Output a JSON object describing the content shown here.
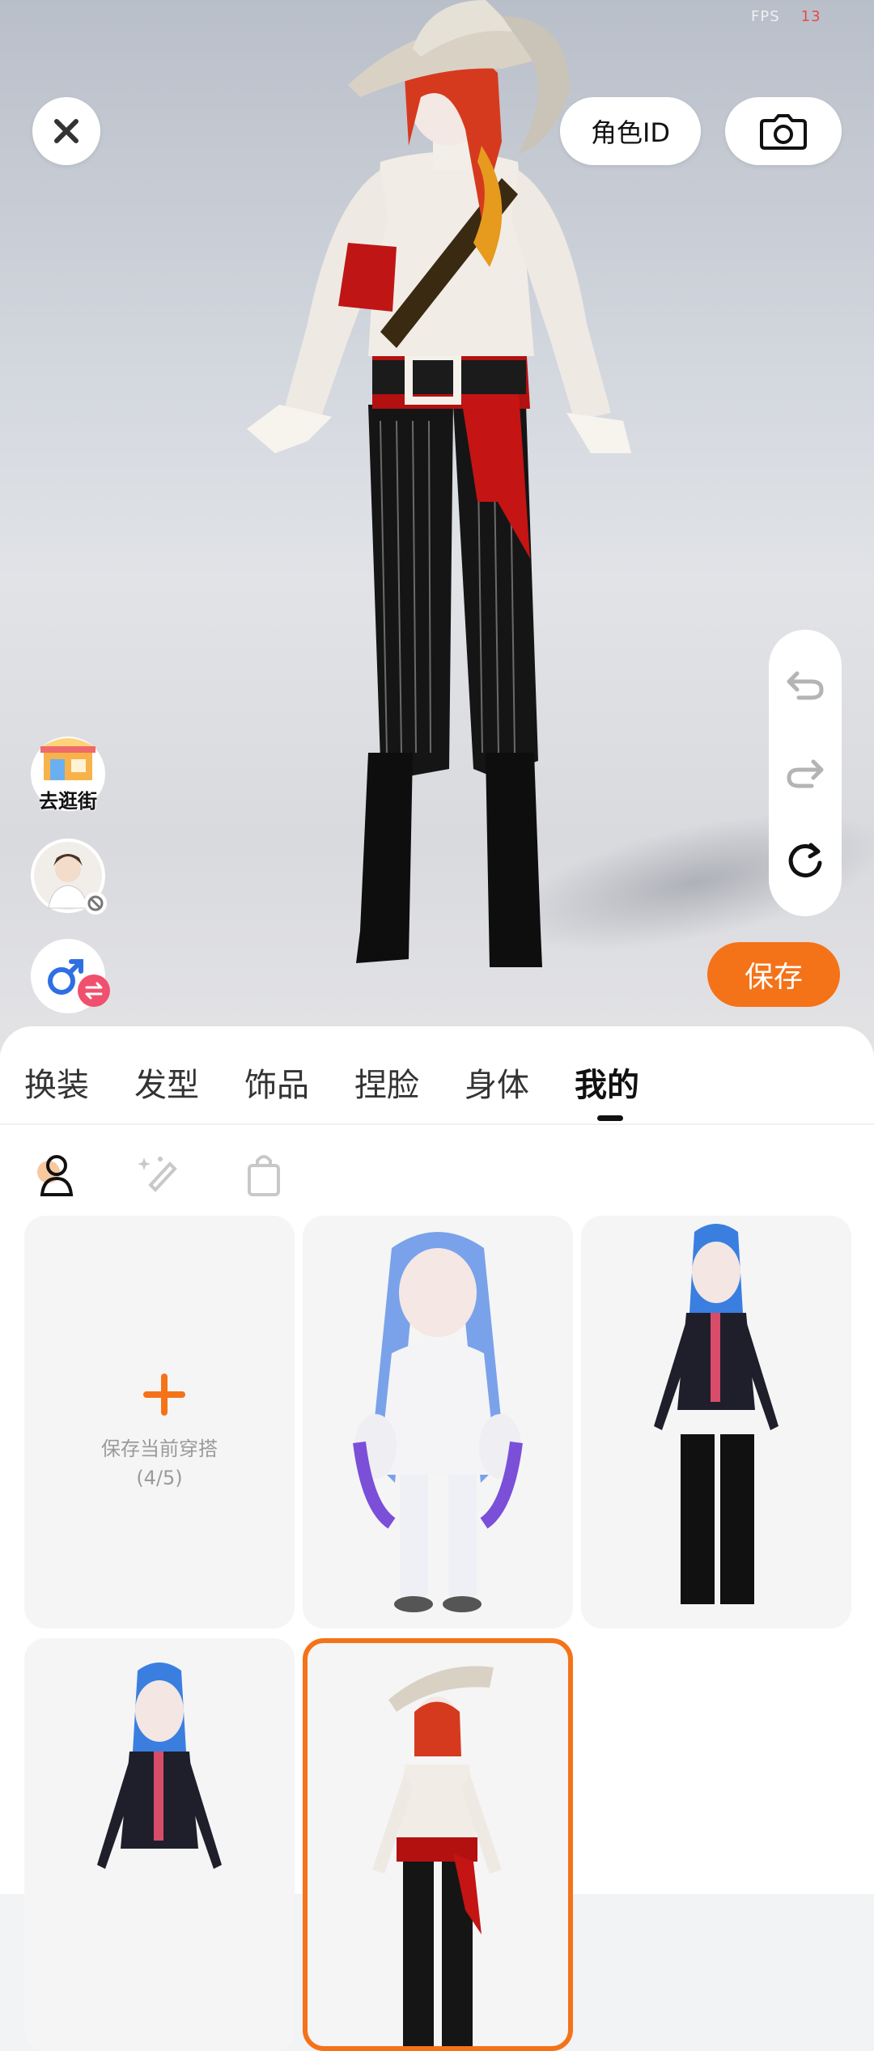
{
  "hud": {
    "fps_label": "FPS",
    "fps_value": "13"
  },
  "top_bar": {
    "role_id_label": "角色ID"
  },
  "side": {
    "shop_label": "去逛街"
  },
  "actions": {
    "save_label": "保存"
  },
  "tabs": [
    {
      "label": "换装",
      "active": false
    },
    {
      "label": "发型",
      "active": false
    },
    {
      "label": "饰品",
      "active": false
    },
    {
      "label": "捏脸",
      "active": false
    },
    {
      "label": "身体",
      "active": false
    },
    {
      "label": "我的",
      "active": true
    }
  ],
  "subtabs": [
    "person-icon",
    "sparkle-brush-icon",
    "shopping-bag-icon"
  ],
  "outfits": {
    "add_label": "保存当前穿搭",
    "add_count": "(4/5)",
    "items": [
      {
        "name": "white-hoodie-blue-hair-outfit",
        "selected": false
      },
      {
        "name": "black-jacket-blue-hair-outfit",
        "selected": false
      },
      {
        "name": "black-jacket-blue-hair-outfit-2",
        "selected": false
      },
      {
        "name": "pirate-outfit",
        "selected": true
      }
    ]
  },
  "colors": {
    "accent": "#f47319",
    "badge_pink": "#f0506e",
    "male_blue": "#2f6fe4"
  }
}
